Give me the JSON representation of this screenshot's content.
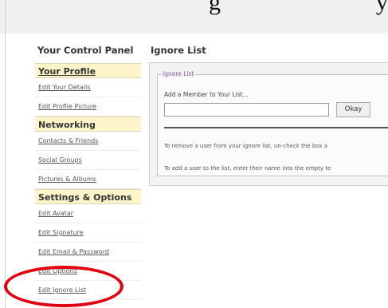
{
  "header_text": "g",
  "header_text_right": "y",
  "control_panel_title": "Your Control Panel",
  "ignore_list_title": "Ignore List",
  "sidebar": {
    "sections": [
      {
        "label": "Your Profile",
        "items": [
          "Edit Your Details",
          "Edit Profile Picture"
        ]
      },
      {
        "label": "Networking",
        "items": [
          "Contacts & Friends",
          "Social Groups",
          "Pictures & Albums"
        ]
      },
      {
        "label": "Settings & Options",
        "items": [
          "Edit Avatar",
          "Edit Signature",
          "Edit Email & Password",
          "Edit Options",
          "Edit Ignore List"
        ]
      }
    ]
  },
  "ignore_panel": {
    "legend": "Ignore List",
    "add_label": "Add a Member to Your List...",
    "input_value": "",
    "okay_button": "Okay",
    "help_remove": "To remove a user from your ignore list, un-check the box a",
    "help_add": "To add a user to the list, enter their name into the empty te"
  },
  "annotation_color": "#e30010"
}
